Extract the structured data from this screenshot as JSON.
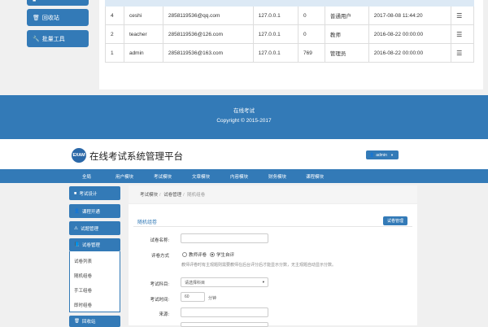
{
  "top_sidebar": {
    "items": [
      {
        "label": "",
        "icon": "th-icon"
      },
      {
        "label": "回收站",
        "icon": "trash-icon"
      },
      {
        "label": "批量工具",
        "icon": "wrench-icon"
      }
    ]
  },
  "top_table": {
    "rows": [
      {
        "no": "4",
        "username": "ceshi",
        "email": "2858119536@qq.com",
        "ip": "127.0.0.1",
        "count": "0",
        "role": "普通用户",
        "time": "2017-08-08 11:44:20"
      },
      {
        "no": "2",
        "username": "teacher",
        "email": "2858119536@126.com",
        "ip": "127.0.0.1",
        "count": "0",
        "role": "教师",
        "time": "2016-08-22 00:00:00"
      },
      {
        "no": "1",
        "username": "admin",
        "email": "2858119536@163.com",
        "ip": "127.0.0.1",
        "count": "769",
        "role": "管理员",
        "time": "2016-08-22 00:00:00"
      }
    ],
    "action_icon": "list-icon"
  },
  "footer": {
    "line1": "在线考试",
    "line2": "Copyright © 2015-2017"
  },
  "header": {
    "logo_text": "EXAM",
    "title": "在线考试系统管理平台",
    "user_label": "admin"
  },
  "nav": {
    "items": [
      "全局",
      "用户模块",
      "考试模块",
      "文章模块",
      "内容模块",
      "财务模块",
      "课程模块"
    ]
  },
  "sidebar": {
    "items": [
      {
        "label": "考试设计",
        "icon": "th-icon"
      },
      {
        "label": "课程开通",
        "icon": "user-icon"
      },
      {
        "label": "试题管理",
        "icon": "warning-icon"
      },
      {
        "label": "试卷管理",
        "icon": "book-icon"
      },
      {
        "label": "回收站",
        "icon": "trash-icon"
      }
    ],
    "sub_items": [
      "试卷列表",
      "随机组卷",
      "手工组卷",
      "即时组卷"
    ]
  },
  "breadcrumb": {
    "items": [
      "考试模块",
      "试卷管理",
      "随机组卷"
    ]
  },
  "panel": {
    "title": "随机组卷",
    "manage_button": "试卷管理"
  },
  "form": {
    "name_label": "试卷名称:",
    "name_value": "",
    "method_label": "评卷方式",
    "option_teacher": "教师评卷",
    "option_student": "学生自评",
    "selected": "student",
    "hint": "教师评卷时有主观题则需要教师在后台评分后才能显示分数，无主观题自动显示分数。",
    "subject_label": "考试科目:",
    "subject_value": "请选择科目",
    "time_label": "考试时间:",
    "time_value": "60",
    "time_unit": "分钟",
    "source_label": "来源:",
    "source_value": "",
    "extra_label": "",
    "extra_value": ""
  }
}
